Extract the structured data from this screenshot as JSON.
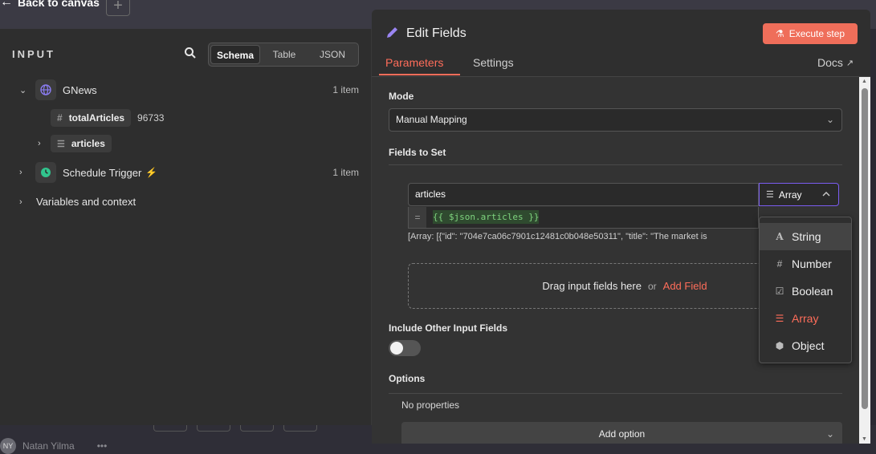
{
  "canvas": {
    "back_label": "Back to canvas",
    "user_initials": "NY",
    "user_name": "Natan Yilma",
    "user_menu": "•••"
  },
  "input": {
    "title": "INPUT",
    "view_tabs": [
      "Schema",
      "Table",
      "JSON"
    ],
    "active_view": "Schema",
    "nodes": [
      {
        "name": "GNews",
        "count": "1 item"
      },
      {
        "name": "Schedule Trigger",
        "count": "1 item"
      }
    ],
    "fields": [
      {
        "name": "totalArticles",
        "value": "96733",
        "type_icon": "#"
      },
      {
        "name": "articles",
        "type_icon": "list"
      }
    ],
    "variables_label": "Variables and context"
  },
  "edit": {
    "title": "Edit Fields",
    "execute_label": "Execute step",
    "tabs": [
      "Parameters",
      "Settings"
    ],
    "docs_label": "Docs",
    "mode_label": "Mode",
    "mode_value": "Manual Mapping",
    "fields_label": "Fields to Set",
    "field_name": "articles",
    "field_type": "Array",
    "expression": "{{ $json.articles }}",
    "preview": "[Array: [{\"id\": \"704e7ca06c7901c12481c0b048e50311\", \"title\": \"The market is",
    "drop_text": "Drag input fields here",
    "drop_or": "or",
    "add_field": "Add Field",
    "include_label": "Include Other Input Fields",
    "options_label": "Options",
    "no_props": "No properties",
    "add_option": "Add option"
  },
  "type_menu": {
    "options": [
      "String",
      "Number",
      "Boolean",
      "Array",
      "Object"
    ],
    "hovered": "String",
    "selected": "Array"
  },
  "colors": {
    "accent": "#ff6d5a",
    "panel": "#333333",
    "background": "#2e2e2e"
  }
}
